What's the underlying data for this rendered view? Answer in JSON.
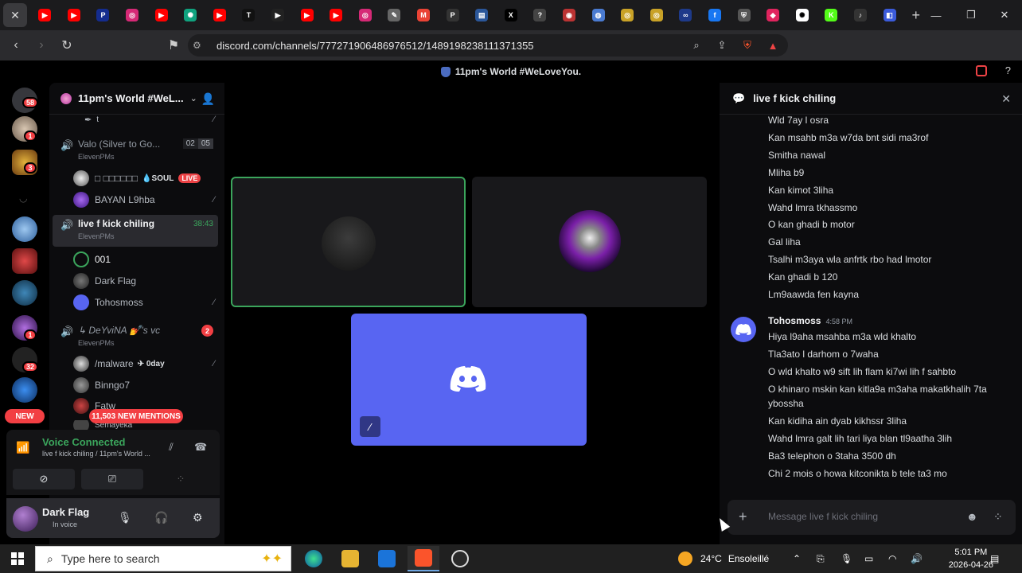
{
  "browser": {
    "tab_icons": [
      {
        "name": "youtube-icon",
        "color": "#ff0000",
        "glyph": "▶"
      },
      {
        "name": "youtube-icon",
        "color": "#ff0000",
        "glyph": "▶"
      },
      {
        "name": "paypal-icon",
        "color": "#142c8e",
        "glyph": "P"
      },
      {
        "name": "instagram-icon",
        "color": "#d62976",
        "glyph": "◎"
      },
      {
        "name": "youtube-icon",
        "color": "#ff0000",
        "glyph": "▶"
      },
      {
        "name": "chatgpt-icon",
        "color": "#10a37f",
        "glyph": "✺"
      },
      {
        "name": "youtube-icon",
        "color": "#ff0000",
        "glyph": "▶"
      },
      {
        "name": "tiktok-icon",
        "color": "#111111",
        "glyph": "T"
      },
      {
        "name": "play-icon",
        "color": "#222222",
        "glyph": "▶"
      },
      {
        "name": "youtube-icon",
        "color": "#ff0000",
        "glyph": "▶"
      },
      {
        "name": "youtube-icon",
        "color": "#ff0000",
        "glyph": "▶"
      },
      {
        "name": "instagram-icon",
        "color": "#d62976",
        "glyph": "◎"
      },
      {
        "name": "tag-icon",
        "color": "#666666",
        "glyph": "✎"
      },
      {
        "name": "gmail-icon",
        "color": "#ea4335",
        "glyph": "M"
      },
      {
        "name": "p-icon",
        "color": "#333333",
        "glyph": "P"
      },
      {
        "name": "doc-icon",
        "color": "#2b579a",
        "glyph": "▤"
      },
      {
        "name": "x-icon",
        "color": "#000000",
        "glyph": "X"
      },
      {
        "name": "question-icon",
        "color": "#444444",
        "glyph": "?"
      },
      {
        "name": "target-icon",
        "color": "#b33",
        "glyph": "◉"
      },
      {
        "name": "globe-icon",
        "color": "#4a7bd1",
        "glyph": "◍"
      },
      {
        "name": "coin-icon",
        "color": "#c9a227",
        "glyph": "◎"
      },
      {
        "name": "coin-icon",
        "color": "#c9a227",
        "glyph": "◎"
      },
      {
        "name": "link-icon",
        "color": "#1e3a8a",
        "glyph": "∞"
      },
      {
        "name": "facebook-icon",
        "color": "#1877f2",
        "glyph": "f"
      },
      {
        "name": "shield-icon",
        "color": "#555555",
        "glyph": "⛨"
      },
      {
        "name": "app-icon",
        "color": "#e0245e",
        "glyph": "◆"
      },
      {
        "name": "openai-icon",
        "color": "#ffffff",
        "glyph": "✺"
      },
      {
        "name": "kick-icon",
        "color": "#53fc18",
        "glyph": "K"
      },
      {
        "name": "audio-icon",
        "color": "#333333",
        "glyph": "♪"
      },
      {
        "name": "active-tab-icon",
        "color": "#3b5bdb",
        "glyph": "◧"
      }
    ],
    "url": "discord.com/channels/777271906486976512/1489198238111371355"
  },
  "discord": {
    "window_title": "11pm's World #WeLoveYou.",
    "guild_badges": {
      "first": "58",
      "second": "1",
      "third": "3",
      "fourth": "1",
      "fifth": "32",
      "new_pill": "NEW"
    },
    "server_name": "11pm's World #WeL...",
    "channels": [
      {
        "name": "Valo (Silver to Go...",
        "sub": "ElevenPMs",
        "count_a": "02",
        "count_b": "05"
      },
      {
        "name": "live f kick chiling",
        "sub": "ElevenPMs",
        "timer": "38:43"
      },
      {
        "name": "↳ DeYviNA 💅's vc",
        "sub": "ElevenPMs",
        "badge": "2"
      }
    ],
    "partial_member": "t",
    "members_valo": [
      {
        "name": "□ □□□□□□",
        "tag": "💧SOUL",
        "live": "LIVE"
      },
      {
        "name": "BAYAN L9hba"
      }
    ],
    "members_live": [
      {
        "name": "001"
      },
      {
        "name": "Dark Flag"
      },
      {
        "name": "Tohosmoss"
      }
    ],
    "members_deyvina": [
      {
        "name": "/malware",
        "tag": "✈ 0day"
      },
      {
        "name": "Binngo7"
      },
      {
        "name": "Fatw"
      },
      {
        "name": "Semayeka"
      }
    ],
    "mentions_pill": "11,503 NEW MENTIONS",
    "voice": {
      "status": "Voice Connected",
      "channel": "live f kick chiling / 11pm's World ..."
    },
    "user": {
      "name": "Dark Flag",
      "status": "In voice"
    },
    "chat": {
      "title": "live f kick chiling",
      "earlier_messages": [
        "Wld 7ay l osra",
        "Kan msahb m3a w7da bnt sidi ma3rof",
        "Smitha nawal",
        "Mliha b9",
        "Kan kimot 3liha",
        "Wahd lmra tkhassmo",
        "O kan ghadi b motor",
        "Gal liha",
        "Tsalhi m3aya wla anfrtk rbo had lmotor",
        "Kan ghadi b 120",
        "Lm9aawda fen kayna"
      ],
      "author": "Tohosmoss",
      "time": "4:58 PM",
      "messages": [
        "Hiya l9aha msahba m3a wld khalto",
        "Tla3ato l darhom o 7waha",
        "O wld khalto w9 sift lih flam ki7wi lih f sahbto",
        "O khinaro mskin kan kitla9a m3aha makatkhalih 7ta ybossha",
        "Kan kidiha ain dyab kikhssr 3liha",
        "Wahd lmra galt lih tari liya blan tl9aatha 3lih",
        "Ba3 telephon o 3taha 3500 dh",
        "Chi 2 mois o howa kitconikta b tele ta3 mo"
      ],
      "placeholder": "Message live f kick chiling"
    }
  },
  "taskbar": {
    "search_placeholder": "Type here to search",
    "weather_temp": "24°C",
    "weather_desc": "Ensoleillé",
    "time": "5:01 PM",
    "date": "2026-04-26"
  },
  "colors": {
    "discord_blurple": "#5865f2",
    "speaking_green": "#3ba55c",
    "mention_red": "#f23f43"
  }
}
